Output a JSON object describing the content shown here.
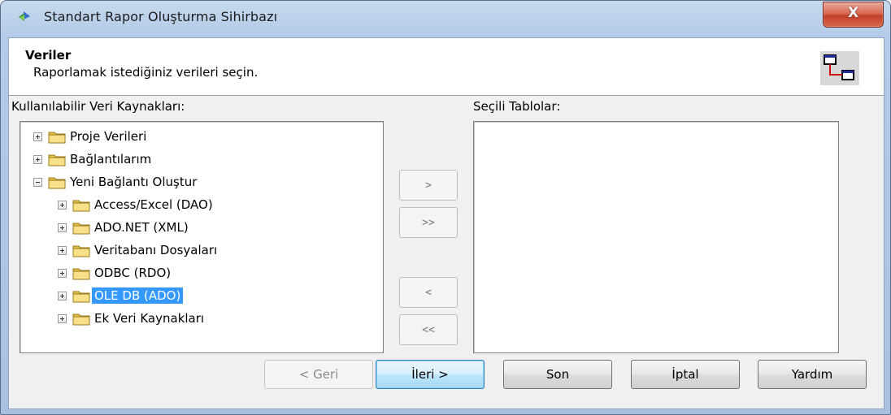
{
  "window": {
    "title": "Standart Rapor Oluşturma Sihirbazı",
    "close_label": "X"
  },
  "header": {
    "title": "Veriler",
    "subtitle": "Raporlamak istediğiniz verileri seçin."
  },
  "available": {
    "label": "Kullanılabilir Veri Kaynakları:",
    "items": [
      {
        "label": "Proje Verileri",
        "expander": "plus",
        "level": 0,
        "selected": false
      },
      {
        "label": "Bağlantılarım",
        "expander": "plus",
        "level": 0,
        "selected": false
      },
      {
        "label": "Yeni Bağlantı Oluştur",
        "expander": "minus",
        "level": 0,
        "selected": false
      },
      {
        "label": "Access/Excel (DAO)",
        "expander": "plus",
        "level": 1,
        "selected": false
      },
      {
        "label": "ADO.NET (XML)",
        "expander": "plus",
        "level": 1,
        "selected": false
      },
      {
        "label": "Veritabanı Dosyaları",
        "expander": "plus",
        "level": 1,
        "selected": false
      },
      {
        "label": "ODBC (RDO)",
        "expander": "plus",
        "level": 1,
        "selected": false
      },
      {
        "label": "OLE DB (ADO)",
        "expander": "plus",
        "level": 1,
        "selected": true
      },
      {
        "label": "Ek Veri Kaynakları",
        "expander": "plus",
        "level": 1,
        "selected": false
      }
    ]
  },
  "selected_tables": {
    "label": "Seçili Tablolar:"
  },
  "move_buttons": {
    "add": ">",
    "add_all": ">>",
    "remove": "<",
    "remove_all": "<<"
  },
  "footer": {
    "back": "< Geri",
    "next": "İleri >",
    "finish": "Son",
    "cancel": "İptal",
    "help": "Yardım"
  },
  "colors": {
    "selection": "#3399ff",
    "title_bar": "#b5cce8",
    "close_button": "#c13f29",
    "folder": "#f1d76c"
  }
}
